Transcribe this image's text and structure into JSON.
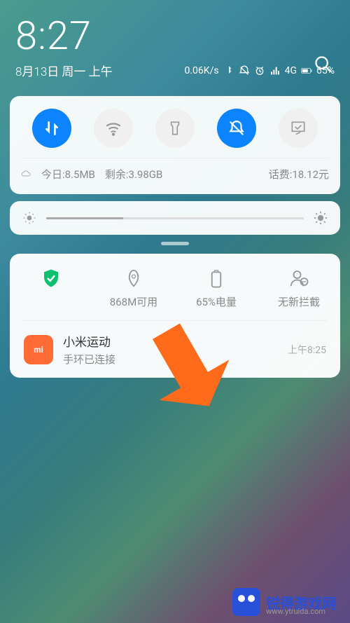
{
  "status": {
    "time": "8:27",
    "date": "8月13日 周一 上午",
    "speed": "0.06K/s",
    "signal": "4G",
    "battery": "65%"
  },
  "quickSettings": {
    "dataUsage": {
      "today_label": "今日:8.5MB",
      "remain_label": "剩余:3.98GB",
      "balance_label": "话费:18.12元"
    }
  },
  "tools": {
    "security_label": "",
    "memory_label": "868M可用",
    "battery_label": "65%电量",
    "block_label": "无新拦截"
  },
  "notification": {
    "app_name": "小米运动",
    "subtitle": "手环已连接",
    "time": "上午8:25",
    "app_icon_text": "mi"
  },
  "watermark": {
    "brand": "锐得游戏网",
    "url": "www.ytruida.com"
  }
}
